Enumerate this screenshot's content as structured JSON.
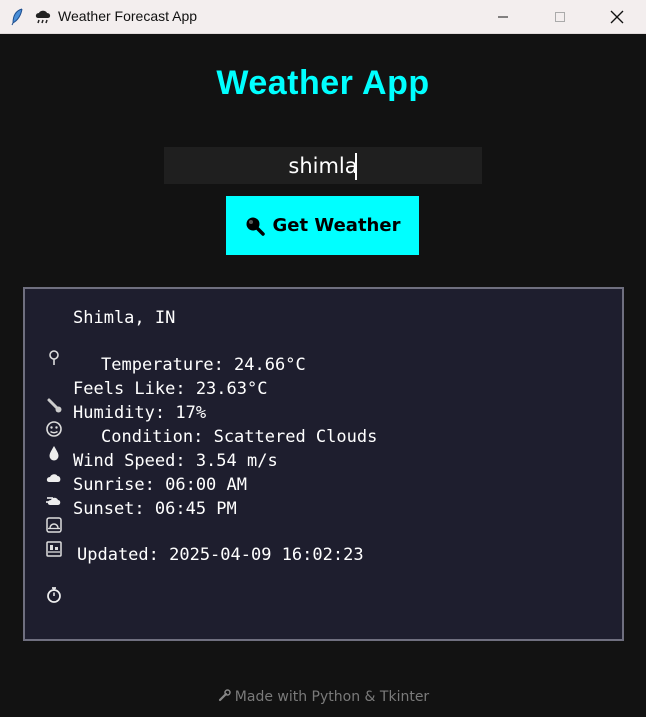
{
  "window": {
    "title": "Weather Forecast App",
    "icons": [
      "feather-icon",
      "cloud-rain-icon"
    ]
  },
  "header": {
    "title": "Weather App"
  },
  "search": {
    "value": "shimla"
  },
  "action": {
    "label": "Get Weather",
    "icon": "magnifier-icon"
  },
  "result": {
    "location": "Shimla, IN",
    "temperature": "Temperature: 24.66°C",
    "feels_like": "Feels Like: 23.63°C",
    "humidity": "Humidity: 17%",
    "condition": "Condition: Scattered Clouds",
    "wind": "Wind Speed: 3.54 m/s",
    "sunrise": "Sunrise: 06:00 AM",
    "sunset": "Sunset: 06:45 PM",
    "updated": "Updated: 2025-04-09 16:02:23"
  },
  "footer": {
    "text": "Made with Python & Tkinter"
  },
  "colors": {
    "accent": "#00ffff",
    "background": "#121212",
    "panel": "#1e1e2e",
    "panel_border": "#6f6f7f",
    "input_bg": "#1f1f1f"
  }
}
